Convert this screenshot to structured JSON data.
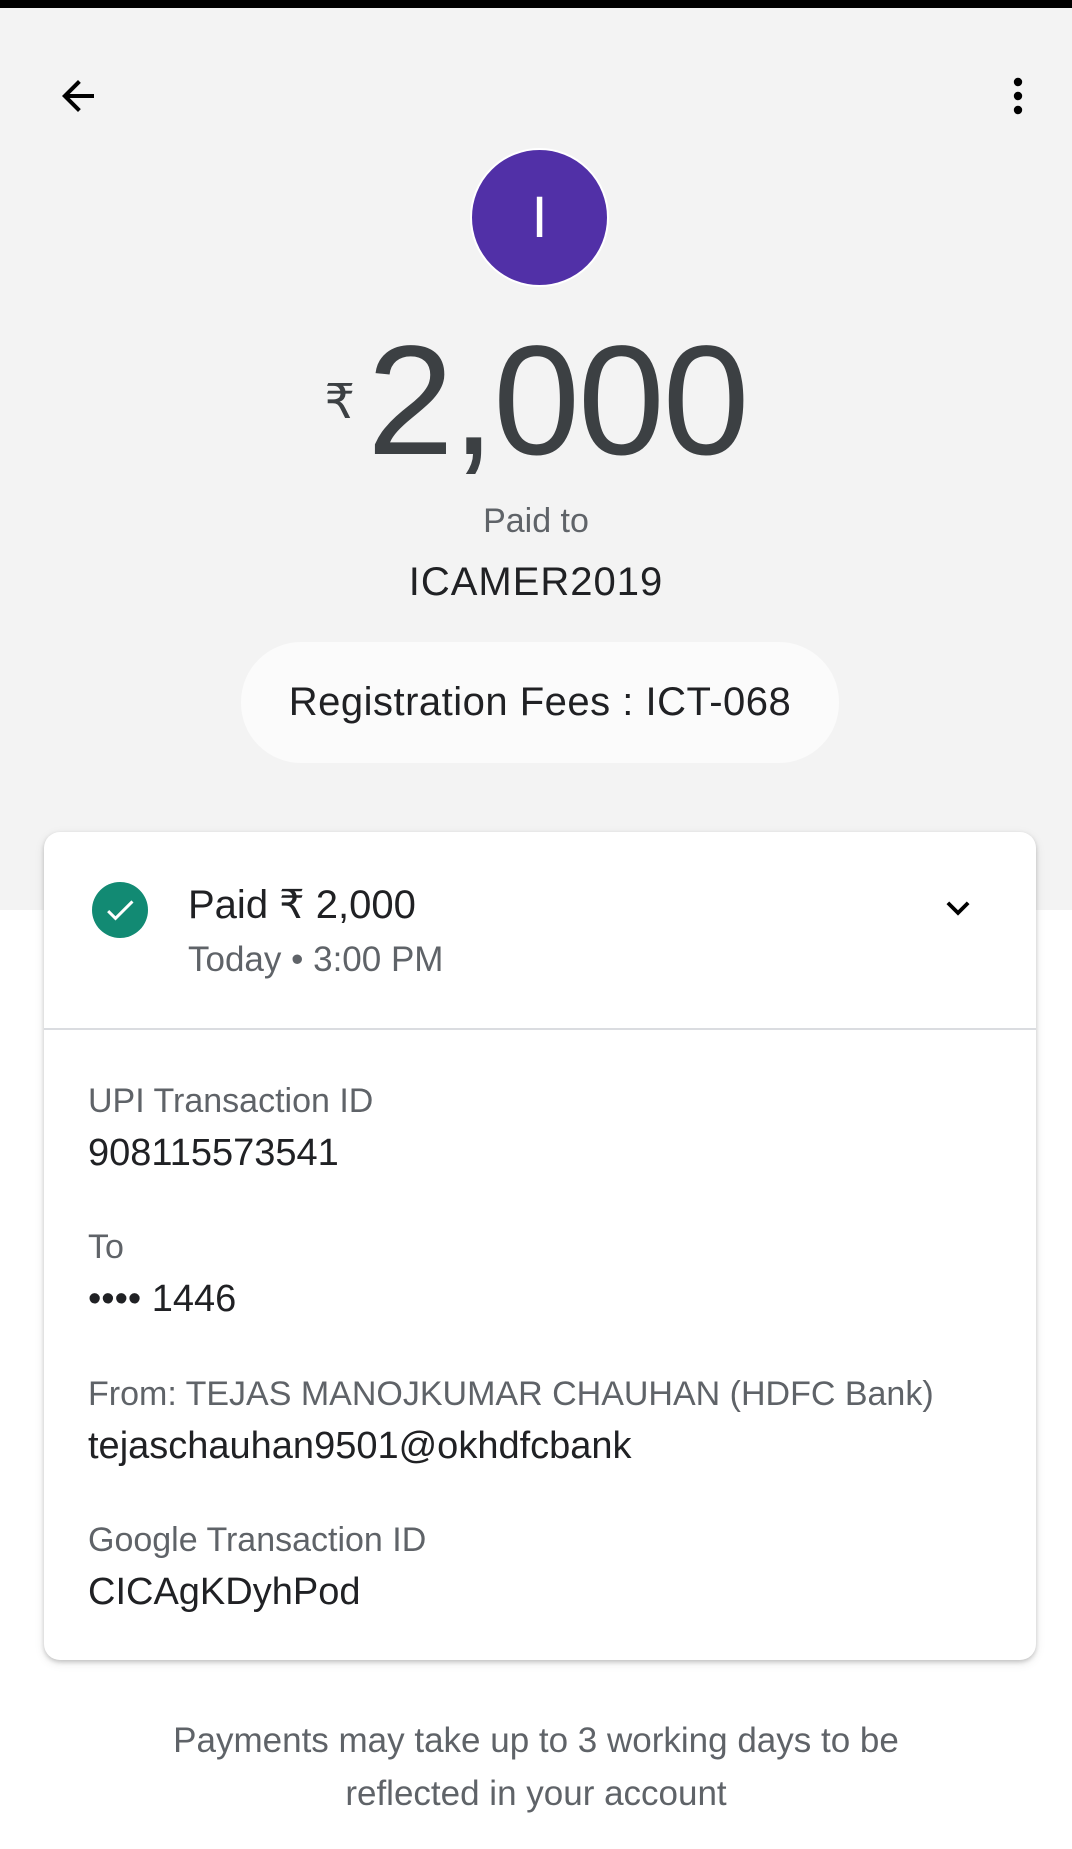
{
  "colors": {
    "avatar_bg": "#5130a7",
    "success": "#128a73",
    "hero_bg": "#f3f3f3"
  },
  "icons": {
    "back": "arrow-left-icon",
    "menu": "more-vertical-icon",
    "status": "check-circle-icon",
    "expand": "chevron-down-icon"
  },
  "header": {
    "avatar_initial": "I",
    "currency_symbol": "₹",
    "amount": "2,000",
    "paid_to_label": "Paid to",
    "payee_name": "ICAMER2019",
    "note": "Registration Fees : ICT-068"
  },
  "status_card": {
    "status_text": "Paid ₹ 2,000",
    "timestamp": "Today • 3:00 PM",
    "details": [
      {
        "label": "UPI Transaction ID",
        "value": "908115573541"
      },
      {
        "label": "To",
        "value": "•••• 1446"
      },
      {
        "label": "From: TEJAS MANOJKUMAR CHAUHAN (HDFC Bank)",
        "value": "tejaschauhan9501@okhdfcbank"
      },
      {
        "label": "Google Transaction ID",
        "value": "CICAgKDyhPod"
      }
    ]
  },
  "footer": {
    "line1": "Payments may take up to 3 working days to be",
    "line2": "reflected in your account"
  }
}
